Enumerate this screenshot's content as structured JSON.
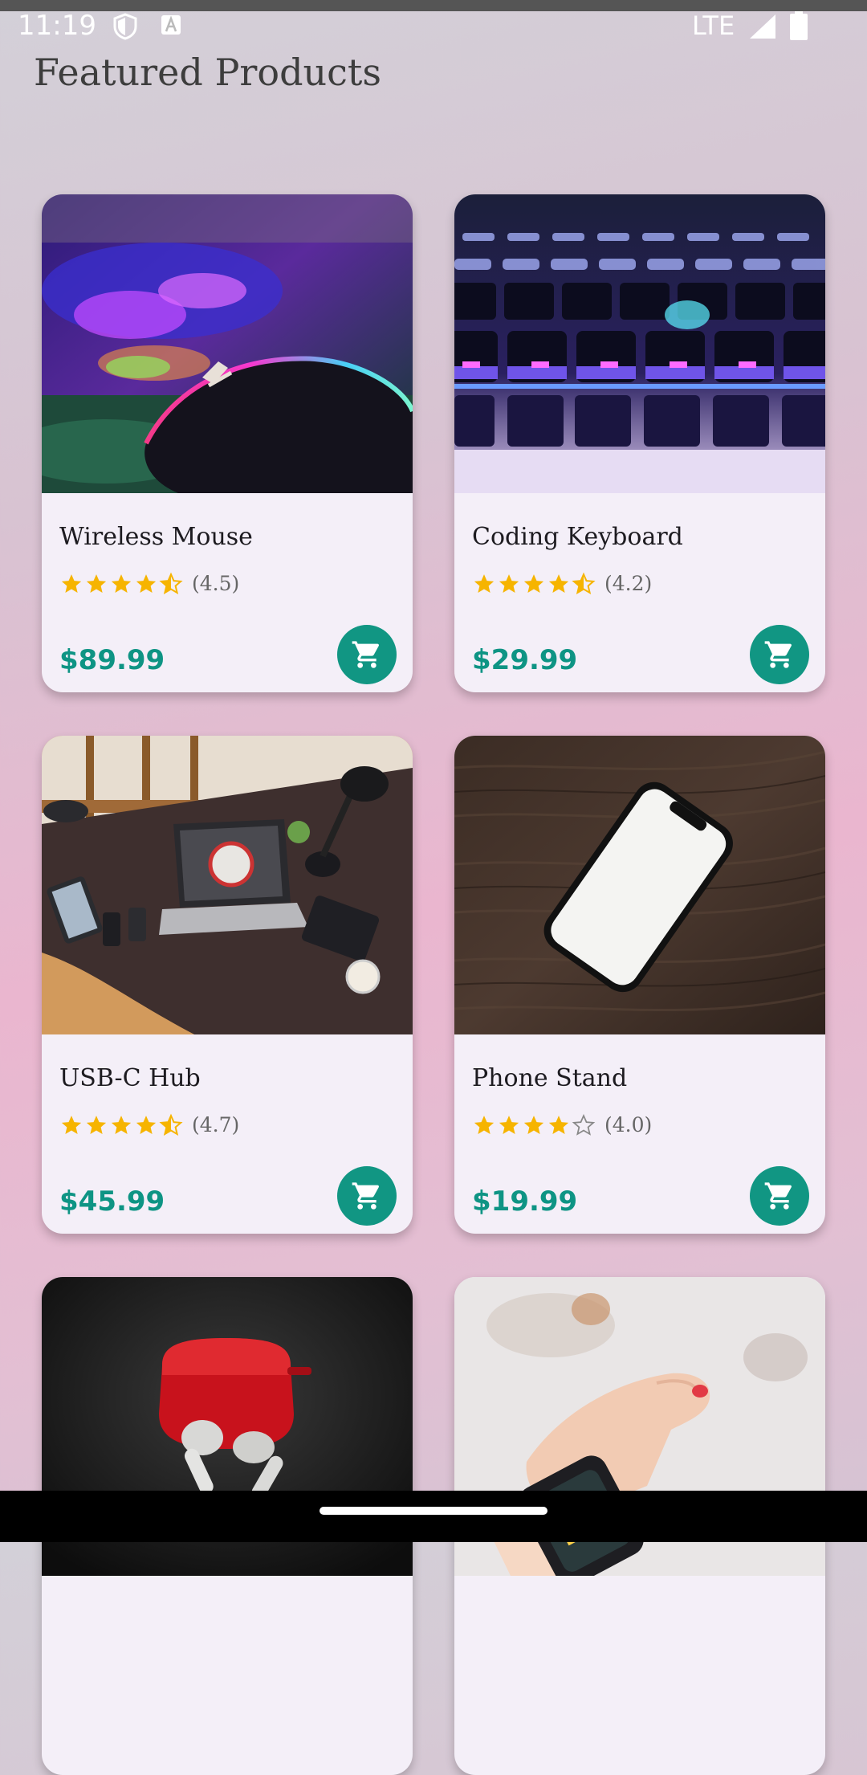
{
  "status_bar": {
    "time": "11:19",
    "network": "LTE"
  },
  "page_title": "Featured Products",
  "colors": {
    "price": "#0e9484",
    "cart_button": "#119683",
    "star": "#f6b400",
    "card_bg": "#f4eff8"
  },
  "products": [
    {
      "name": "Wireless Mouse",
      "rating": 4.5,
      "rating_label": "(4.5)",
      "price": "$89.99",
      "image": "gaming-mouse-photo"
    },
    {
      "name": "Coding Keyboard",
      "rating": 4.5,
      "rating_label": "(4.2)",
      "price": "$29.99",
      "image": "backlit-keyboard-photo"
    },
    {
      "name": "USB-C Hub",
      "rating": 4.5,
      "rating_label": "(4.7)",
      "price": "$45.99",
      "image": "desk-laptop-photo"
    },
    {
      "name": "Phone Stand",
      "rating": 4.0,
      "rating_label": "(4.0)",
      "price": "$19.99",
      "image": "phone-on-table-photo"
    },
    {
      "name": "",
      "image": "red-earbuds-case-photo"
    },
    {
      "name": "",
      "image": "smartwatch-wrist-photo"
    }
  ]
}
